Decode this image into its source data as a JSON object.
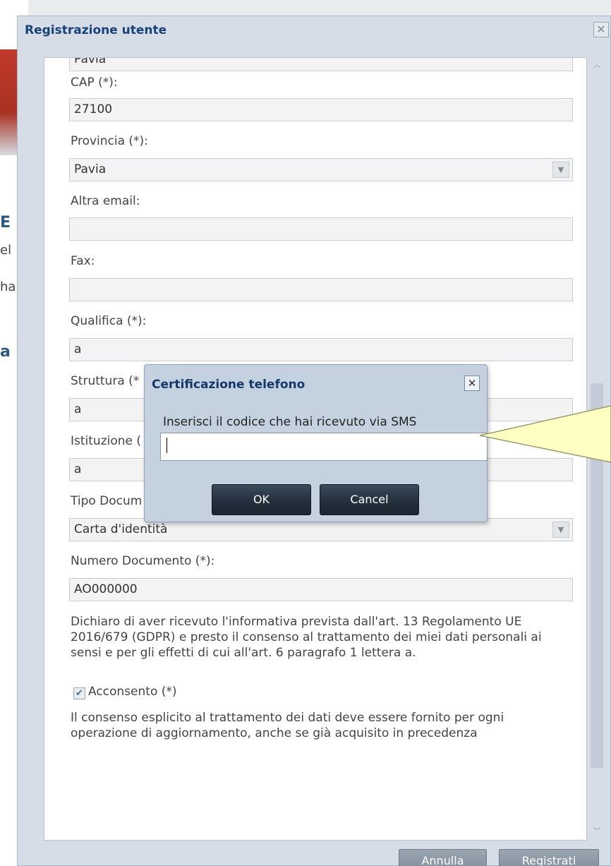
{
  "background": {
    "fragments": [
      "E",
      "el",
      "ha",
      "a"
    ]
  },
  "window": {
    "title": "Registrazione utente",
    "close_glyph": "✕"
  },
  "form": {
    "cut_value": "Pavia",
    "cap_label": "CAP (*):",
    "cap_value": "27100",
    "provincia_label": "Provincia (*):",
    "provincia_value": "Pavia",
    "altra_email_label": "Altra email:",
    "altra_email_value": "",
    "fax_label": "Fax:",
    "fax_value": "",
    "qualifica_label": "Qualifica (*):",
    "qualifica_value": "a",
    "struttura_label": "Struttura (*",
    "struttura_value": "a",
    "istituzione_label": "Istituzione (",
    "istituzione_value": "a",
    "tipo_documento_label": "Tipo Docum",
    "tipo_documento_value": "Carta d'identità",
    "numero_documento_label": "Numero Documento (*):",
    "numero_documento_value": "AO000000",
    "privacy_text": "Dichiaro di aver ricevuto l'informativa prevista dall'art. 13 Regolamento UE 2016/679 (GDPR) e presto il consenso al trattamento dei miei dati personali ai sensi e per gli effetti di cui all'art. 6 paragrafo 1 lettera a.",
    "consent_label": "Acconsento (*)",
    "consent_checked": true,
    "consent_note": "Il consenso esplicito al trattamento dei dati deve essere fornito per ogni operazione di aggiornamento, anche se già acquisito in precedenza"
  },
  "footer": {
    "cancel_label": "Annulla",
    "register_label": "Registrati"
  },
  "modal": {
    "title": "Certificazione telefono",
    "close_glyph": "✕",
    "prompt": "Inserisci il codice che hai ricevuto via SMS",
    "input_value": "",
    "ok_label": "OK",
    "cancel_label": "Cancel"
  },
  "colors": {
    "title_blue": "#15427a",
    "button_dark": "#24323f",
    "tooltip_yellow": "#ffffc4"
  }
}
